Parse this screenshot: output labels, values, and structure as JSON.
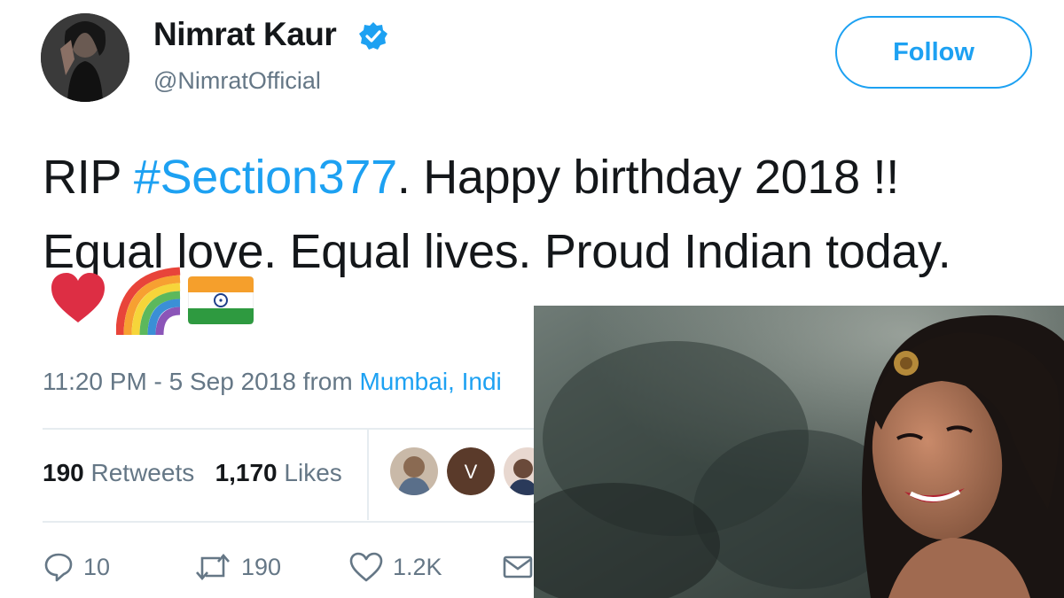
{
  "tweet": {
    "author": {
      "display_name": "Nimrat Kaur",
      "handle": "@NimratOfficial",
      "avatar_icon": "avatar-photo",
      "verified_icon": "verified-badge-icon",
      "verified_color": "#1da1f2"
    },
    "follow_label": "Follow",
    "text": {
      "line1_prefix": "RIP ",
      "hashtag": "#Section377",
      "line1_suffix": ". Happy birthday 2018 !!",
      "line2": "Equal love. Equal lives. Proud Indian today."
    },
    "emojis": [
      "heart-emoji",
      "rainbow-emoji",
      "india-flag-emoji"
    ],
    "timestamp": {
      "time_date": "11:20 PM - 5 Sep 2018 from ",
      "location": "Mumbai, Indi"
    },
    "stats": {
      "retweets_count": "190",
      "retweets_label": "Retweets",
      "likes_count": "1,170",
      "likes_label": "Likes",
      "liker_initial": "V"
    },
    "actions": {
      "reply_count": "10",
      "retweet_count": "190",
      "like_count": "1.2K"
    },
    "colors": {
      "accent": "#1da1f2",
      "secondary_text": "#657786",
      "primary_text": "#14171a"
    }
  }
}
